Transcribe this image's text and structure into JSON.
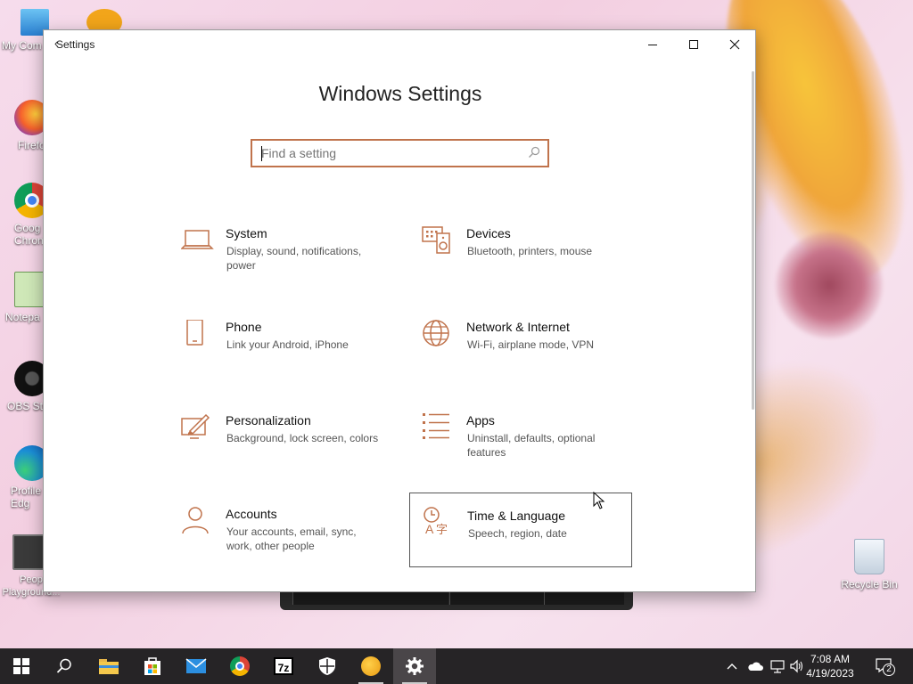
{
  "desktop": {
    "icons": [
      {
        "label": "My Com",
        "icon": "computer-icon"
      },
      {
        "label": "Firefo",
        "icon": "firefox-icon"
      },
      {
        "label": "Goog Chron",
        "icon": "chrome-icon"
      },
      {
        "label": "Notepa",
        "icon": "notepad-icon"
      },
      {
        "label": "OBS Stu",
        "icon": "obs-icon"
      },
      {
        "label": "Profile Edg",
        "icon": "edge-icon"
      },
      {
        "label": "Peop Playground...",
        "icon": "people-playground-icon"
      },
      {
        "label": "Recycle Bin",
        "icon": "recycle-bin-icon"
      }
    ]
  },
  "window": {
    "title": "Settings",
    "back_glyph": "‹",
    "minimize": "─",
    "maximize": "☐",
    "close": "✕"
  },
  "main": {
    "heading": "Windows Settings",
    "search": {
      "placeholder": "Find a setting",
      "value": ""
    },
    "categories": [
      {
        "name": "System",
        "desc": "Display, sound, notifications, power",
        "icon": "laptop-icon"
      },
      {
        "name": "Devices",
        "desc": "Bluetooth, printers, mouse",
        "icon": "devices-icon"
      },
      {
        "name": "Phone",
        "desc": "Link your Android, iPhone",
        "icon": "phone-icon"
      },
      {
        "name": "Network & Internet",
        "desc": "Wi-Fi, airplane mode, VPN",
        "icon": "globe-icon"
      },
      {
        "name": "Personalization",
        "desc": "Background, lock screen, colors",
        "icon": "personalization-icon"
      },
      {
        "name": "Apps",
        "desc": "Uninstall, defaults, optional features",
        "icon": "apps-list-icon"
      },
      {
        "name": "Accounts",
        "desc": "Your accounts, email, sync, work, other people",
        "icon": "person-icon"
      },
      {
        "name": "Time & Language",
        "desc": "Speech, region, date",
        "icon": "time-language-icon"
      }
    ]
  },
  "taskbar": {
    "apps": [
      "start-icon",
      "search-icon",
      "file-explorer-icon",
      "store-icon",
      "mail-icon",
      "chrome-icon",
      "7zip-icon",
      "security-icon",
      "people-playground-icon",
      "settings-icon"
    ],
    "seven_zip_label": "7z",
    "time": "7:08 AM",
    "date": "4/19/2023",
    "notification_count": "2"
  },
  "colors": {
    "accent": "#c0734c",
    "taskbar": "#262426",
    "active_task": "#4a4649"
  }
}
